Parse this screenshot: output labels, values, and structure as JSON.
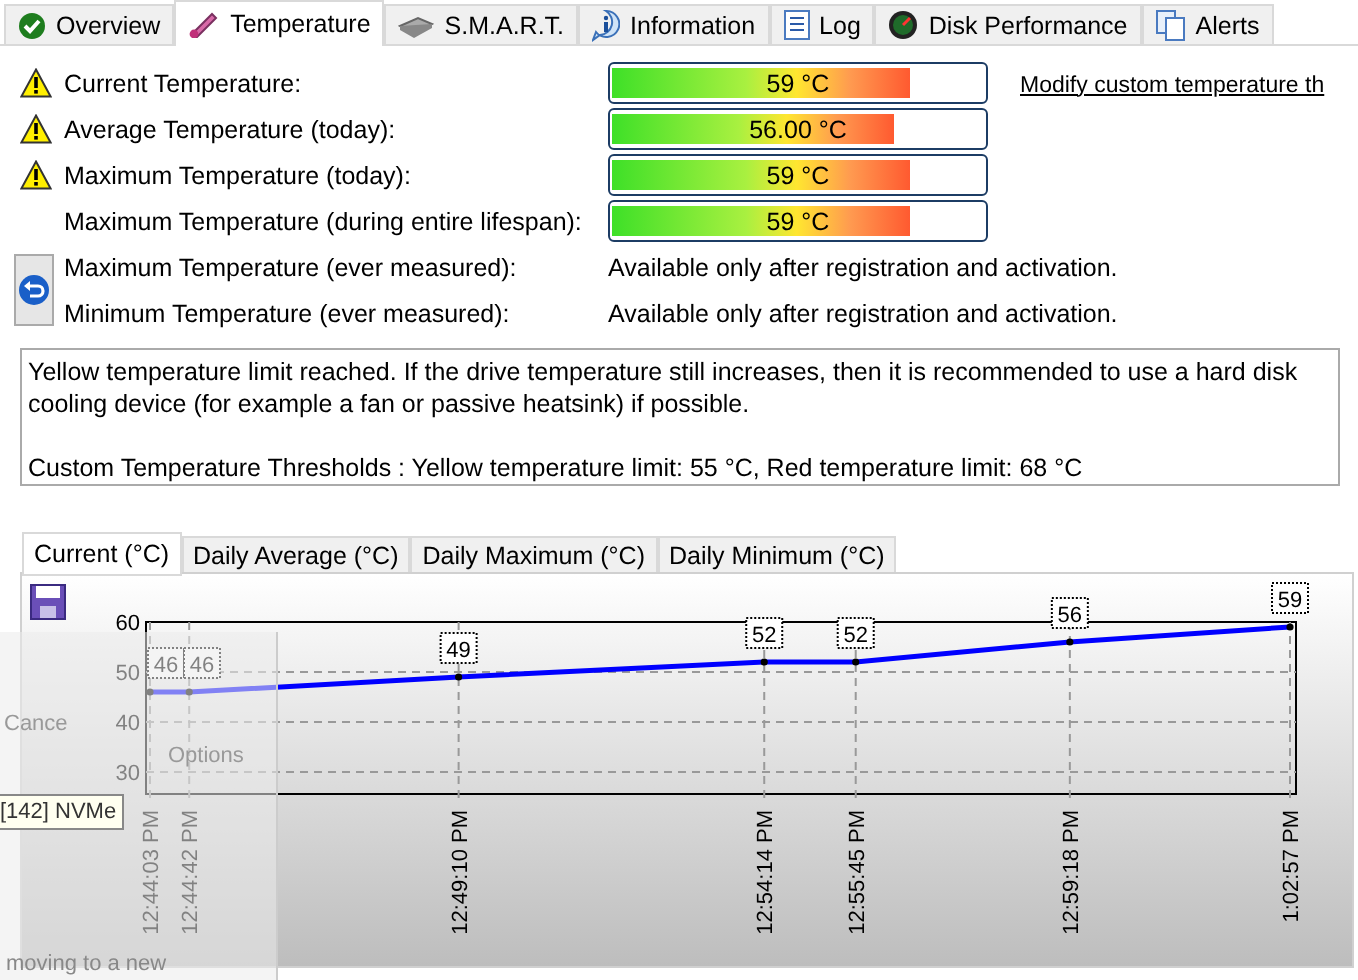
{
  "tabs": [
    {
      "label": "Overview",
      "selected": false
    },
    {
      "label": "Temperature",
      "selected": true
    },
    {
      "label": "S.M.A.R.T.",
      "selected": false
    },
    {
      "label": "Information",
      "selected": false
    },
    {
      "label": "Log",
      "selected": false
    },
    {
      "label": "Disk Performance",
      "selected": false
    },
    {
      "label": "Alerts",
      "selected": false
    }
  ],
  "link": "Modify custom temperature th",
  "readings": [
    {
      "label": "Current Temperature:",
      "warning": true,
      "kind": "bar",
      "value": "59 °C",
      "level": 0.8
    },
    {
      "label": "Average Temperature (today):",
      "warning": true,
      "kind": "bar",
      "value": "56.00 °C",
      "level": 0.76
    },
    {
      "label": "Maximum Temperature (today):",
      "warning": true,
      "kind": "bar",
      "value": "59 °C",
      "level": 0.8
    },
    {
      "label": "Maximum Temperature (during entire lifespan):",
      "warning": false,
      "kind": "bar",
      "value": "59 °C",
      "level": 0.8
    },
    {
      "label": "Maximum Temperature (ever measured):",
      "warning": false,
      "kind": "text",
      "value": "Available only after registration and activation."
    },
    {
      "label": "Minimum Temperature (ever measured):",
      "warning": false,
      "kind": "text",
      "value": "Available only after registration and activation."
    }
  ],
  "history_button": true,
  "message": [
    "Yellow temperature limit reached. If the drive temperature still increases, then it is recommended to use a hard disk cooling device (for example a fan or passive heatsink) if possible.",
    "Custom Temperature Thresholds : Yellow temperature limit: 55 °C, Red temperature limit: 68 °C"
  ],
  "chart_tabs": [
    {
      "label": "Current (°C)",
      "selected": true
    },
    {
      "label": "Daily Average (°C)",
      "selected": false
    },
    {
      "label": "Daily Maximum (°C)",
      "selected": false
    },
    {
      "label": "Daily Minimum (°C)",
      "selected": false
    }
  ],
  "chart": {
    "chart_data": {
      "type": "line",
      "x": [
        "12:44:03 PM",
        "12:44:42 PM",
        "12:49:10 PM",
        "12:54:14 PM",
        "12:55:45 PM",
        "12:59:18 PM",
        "1:02:57 PM"
      ],
      "series": [
        {
          "color": "#0000ff",
          "marker": true,
          "values": [
            46,
            46,
            49,
            52,
            52,
            56,
            59
          ]
        }
      ],
      "ylim": [
        25.6,
        60
      ],
      "yticks": [
        30,
        40,
        50,
        60
      ],
      "grid": true,
      "data_labels": true
    }
  },
  "overlay": {
    "texts": [
      "Cance",
      "Options",
      "moving to a new"
    ],
    "tooltip": "[142] NVMe"
  }
}
